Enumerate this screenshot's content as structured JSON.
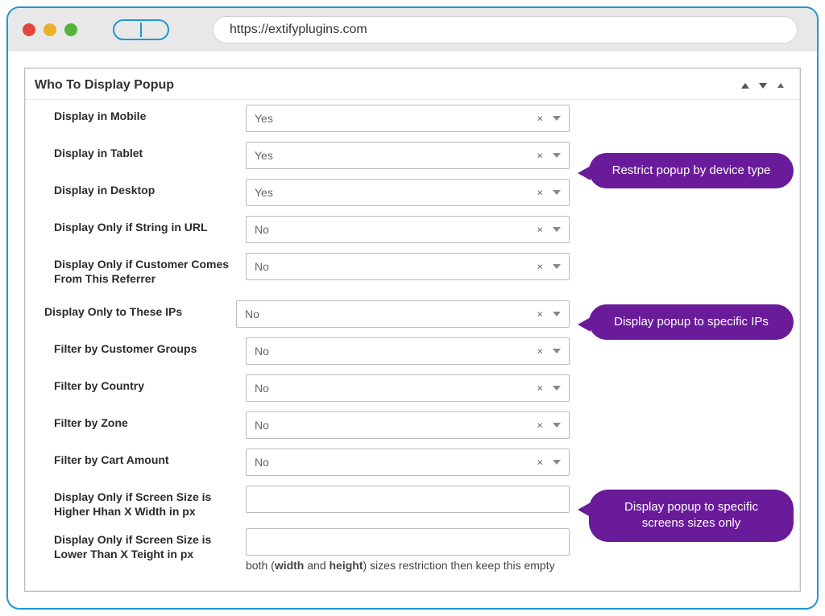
{
  "browser": {
    "url": "https://extifyplugins.com"
  },
  "panel": {
    "title": "Who To Display Popup"
  },
  "rows": {
    "display_mobile": {
      "label": "Display in Mobile",
      "value": "Yes"
    },
    "display_tablet": {
      "label": "Display in Tablet",
      "value": "Yes"
    },
    "display_desktop": {
      "label": "Display in Desktop",
      "value": "Yes"
    },
    "string_url": {
      "label": "Display Only if String in URL",
      "value": "No"
    },
    "referrer": {
      "label": "Display Only if Customer Comes From This Referrer",
      "value": "No"
    },
    "ips": {
      "label": "Display Only to These IPs",
      "value": "No"
    },
    "customer_groups": {
      "label": "Filter by Customer Groups",
      "value": "No"
    },
    "country": {
      "label": "Filter by Country",
      "value": "No"
    },
    "zone": {
      "label": "Filter by Zone",
      "value": "No"
    },
    "cart_amount": {
      "label": "Filter by Cart Amount",
      "value": "No"
    },
    "screen_higher": {
      "label": "Display Only if Screen Size is Higher Hhan X Width in px",
      "value": ""
    },
    "screen_lower": {
      "label": "Display Only if Screen Size is Lower Than X Teight in px",
      "value": ""
    }
  },
  "hint": {
    "prefix": "both (",
    "bold1": "width",
    "mid": " and ",
    "bold2": "height",
    "suffix": ") sizes restriction then keep this empty"
  },
  "callouts": {
    "c1": "Restrict popup by device type",
    "c2": "Display popup to specific IPs",
    "c3": "Display popup to specific screens sizes only"
  }
}
